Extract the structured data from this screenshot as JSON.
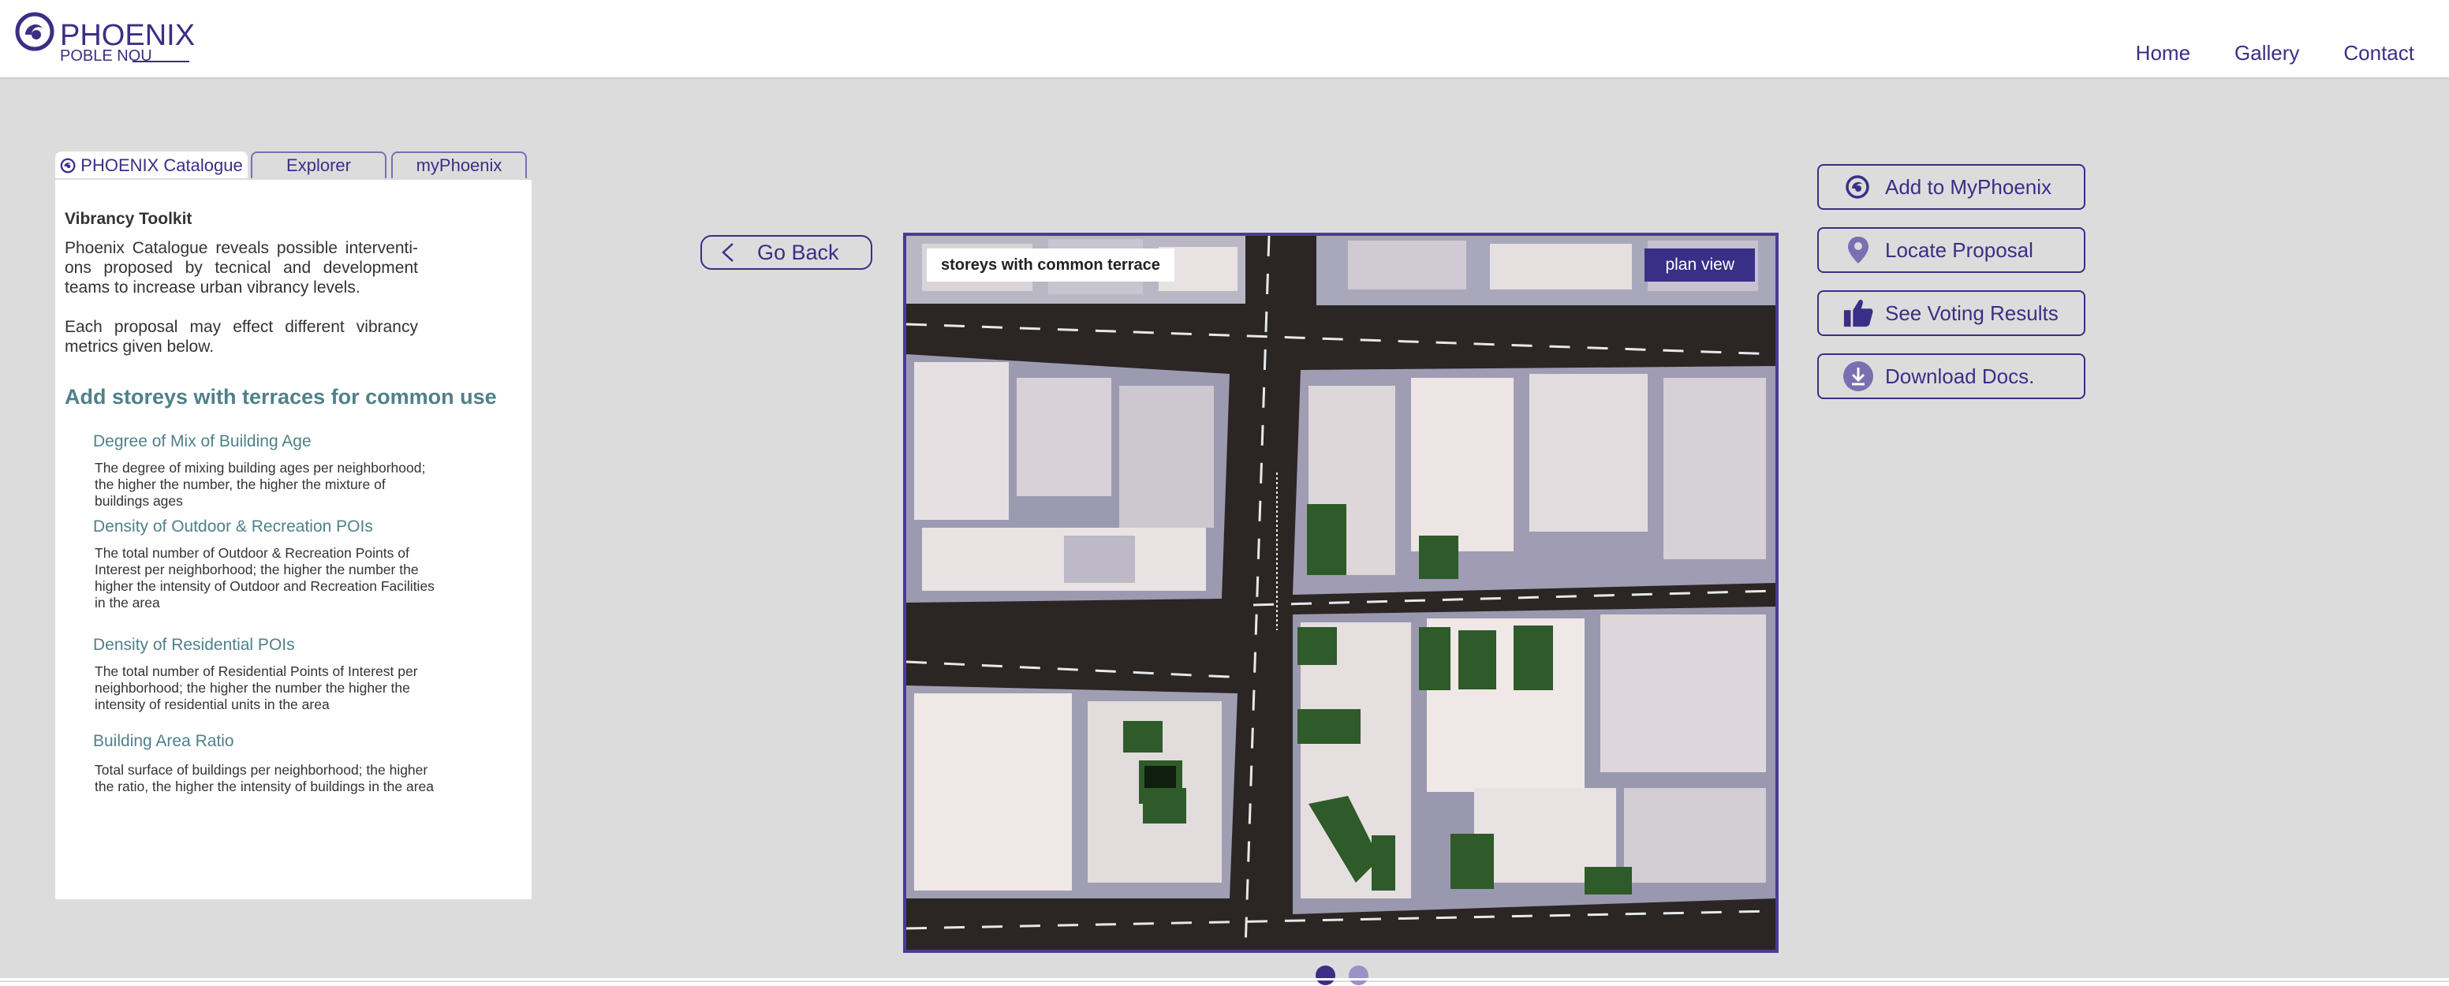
{
  "brand": {
    "title": "PHOENIX",
    "subtitle": "POBLE NOU"
  },
  "nav": [
    "Home",
    "Gallery",
    "Contact"
  ],
  "tabs": [
    "PHOENIX Catalogue",
    "Explorer",
    "myPhoenix"
  ],
  "panel": {
    "title": "Vibrancy Toolkit",
    "para1": "Phoenix Catalogue reveals possible interventi-ons proposed by tecnical and development teams to increase urban vibrancy levels.",
    "para2": "Each proposal may effect different vibrancy metrics given below.",
    "heading": "Add storeys with terraces for common use",
    "metrics": [
      {
        "title": "Degree of Mix of Building Age",
        "desc": "The degree of mixing building ages per neighborhood; the higher the number, the higher the mixture of buildings ages"
      },
      {
        "title": "Density of Outdoor & Recreation POIs",
        "desc": "The total number of Outdoor & Recreation Points of Interest per neighborhood; the higher the number the higher the intensity of Outdoor and Recreation Facilities in the area"
      },
      {
        "title": "Density of Residential POIs",
        "desc": "The total number of Residential Points of Interest per neighborhood; the higher the number the higher the intensity of residential units in the area"
      },
      {
        "title": "Building Area Ratio",
        "desc": "Total surface of buildings per neighborhood; the higher the ratio, the higher the intensity of buildings in the area"
      }
    ]
  },
  "goback": "Go Back",
  "viewer": {
    "caption": "storeys with common terrace",
    "planview": "plan view",
    "active_slide": 1,
    "slides": 2
  },
  "actions": [
    "Add to MyPhoenix",
    "Locate Proposal",
    "See Voting Results",
    "Download Docs."
  ],
  "colors": {
    "accent": "#3a2f86",
    "teal": "#4f8189",
    "background": "#dcdcdc",
    "dot_active": "#3a2f86",
    "dot_inactive": "#9a92c8"
  }
}
